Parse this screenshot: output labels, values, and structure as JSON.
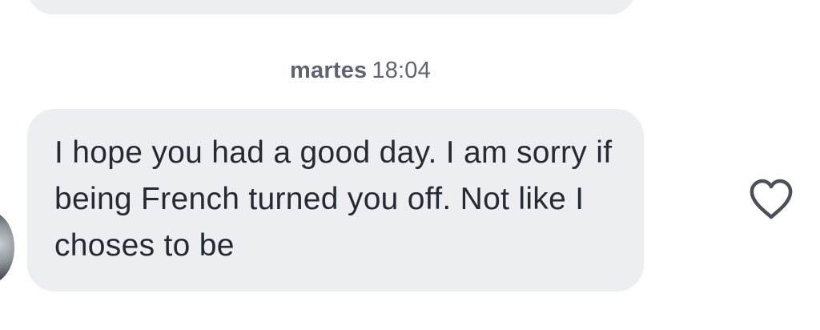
{
  "conversation": {
    "timestamp": {
      "day": "martes",
      "time": "18:04"
    },
    "message": {
      "text": "I hope you had a good day. I am sorry if being French turned you off. Not like I choses to be"
    }
  },
  "icons": {
    "like": "heart-outline-icon"
  },
  "colors": {
    "bubble_background": "#eceef2",
    "text": "#262a31",
    "timestamp": "#5f6470",
    "icon_stroke": "#4a4f58"
  }
}
